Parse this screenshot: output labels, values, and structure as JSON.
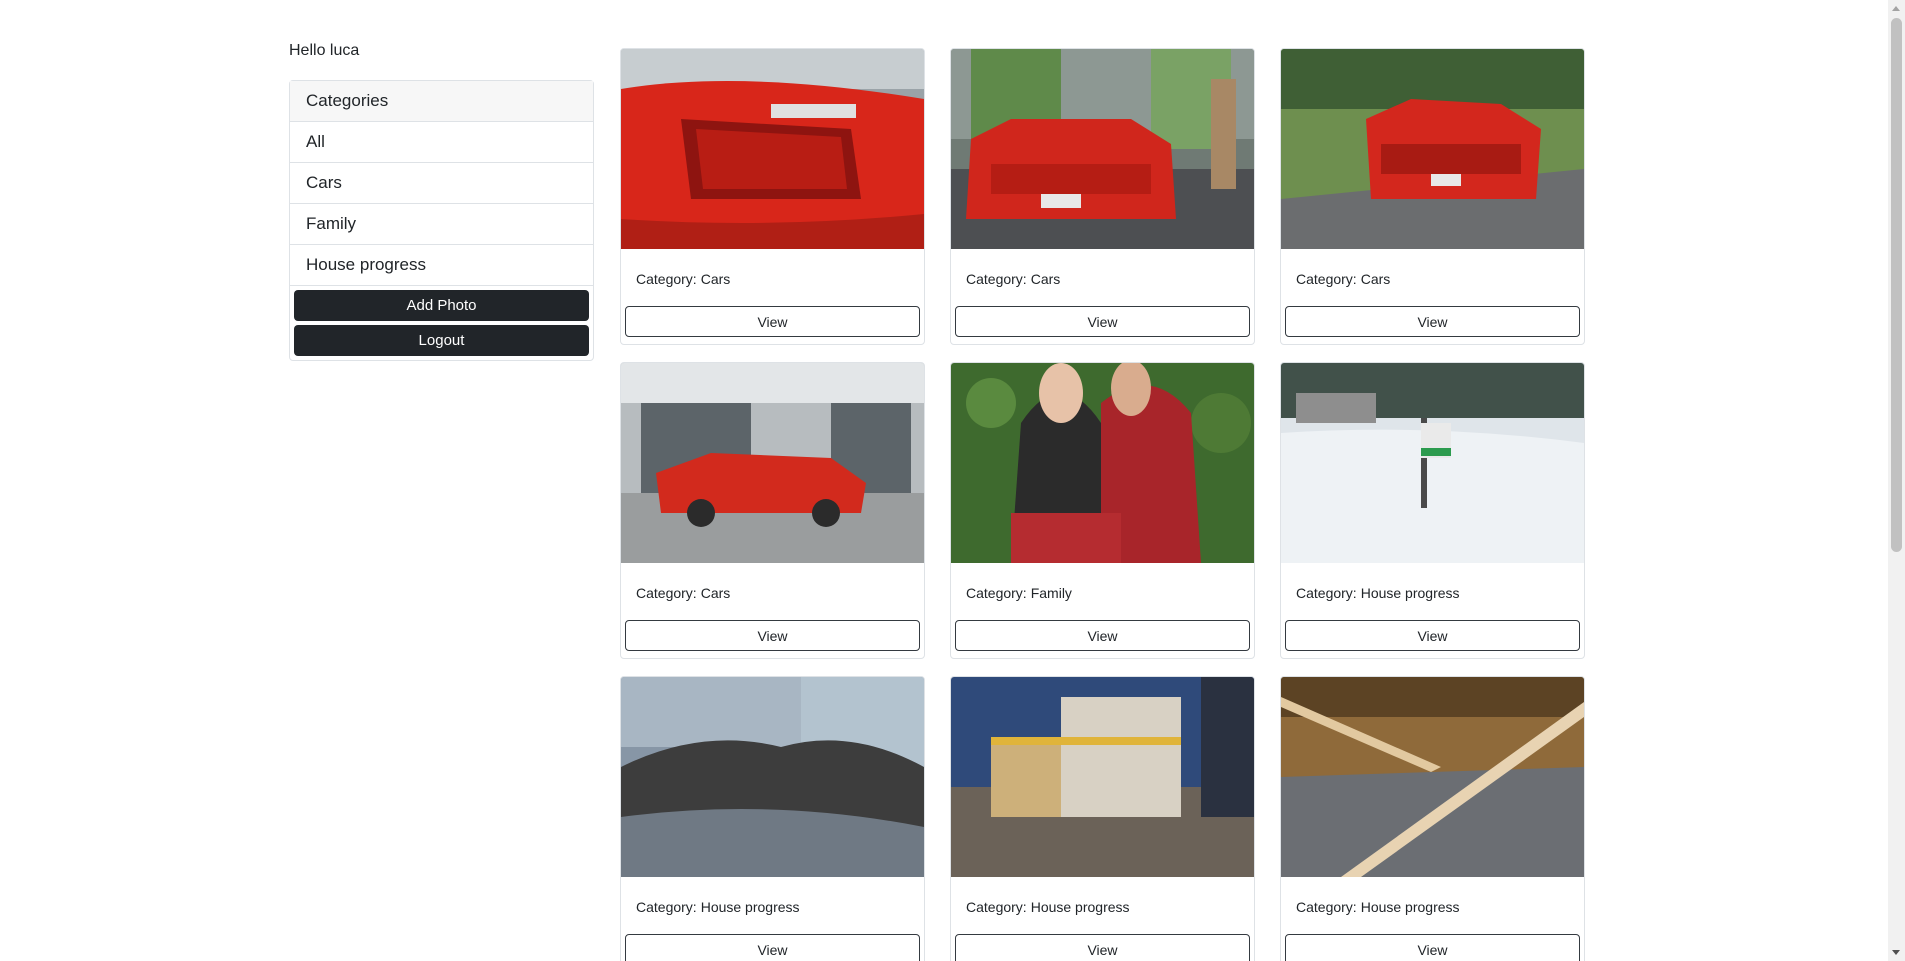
{
  "greeting": "Hello luca",
  "sidebar": {
    "header": "Categories",
    "items": [
      "All",
      "Cars",
      "Family",
      "House progress"
    ],
    "add_photo": "Add Photo",
    "logout": "Logout"
  },
  "photos": [
    {
      "label": "Category:",
      "category": "Cars",
      "view": "View",
      "image": "red-car-rear-500sl-badge"
    },
    {
      "label": "Category:",
      "category": "Cars",
      "view": "View",
      "image": "red-car-front-parked"
    },
    {
      "label": "Category:",
      "category": "Cars",
      "view": "View",
      "image": "red-car-driving-road"
    },
    {
      "label": "Category:",
      "category": "Cars",
      "view": "View",
      "image": "red-convertible-side"
    },
    {
      "label": "Category:",
      "category": "Family",
      "view": "View",
      "image": "couple-portrait"
    },
    {
      "label": "Category:",
      "category": "House progress",
      "view": "View",
      "image": "snowy-lot-sign"
    },
    {
      "label": "Category:",
      "category": "House progress",
      "view": "View",
      "image": "dirt-lot-excavation"
    },
    {
      "label": "Category:",
      "category": "House progress",
      "view": "View",
      "image": "house-framing-evening"
    },
    {
      "label": "Category:",
      "category": "House progress",
      "view": "View",
      "image": "interior-floor-boards"
    }
  ]
}
